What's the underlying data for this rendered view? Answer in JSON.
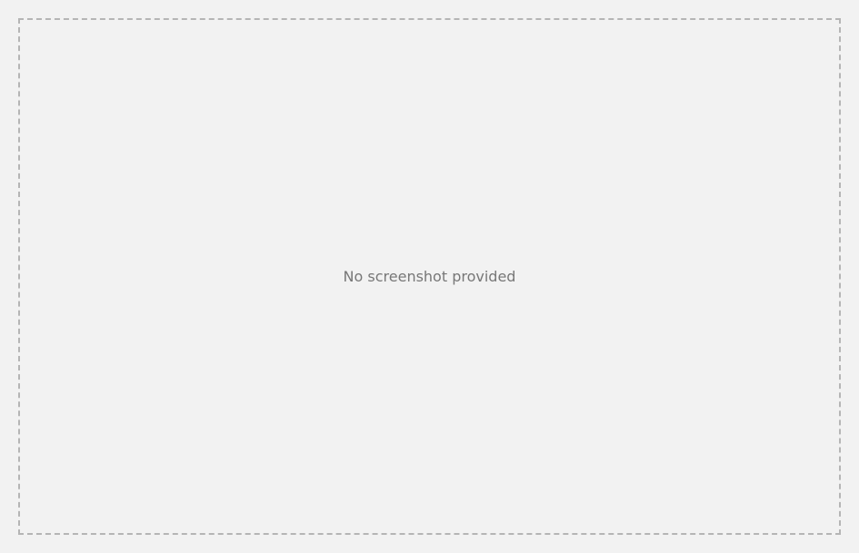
{
  "placeholder": {
    "message": "No screenshot provided"
  }
}
